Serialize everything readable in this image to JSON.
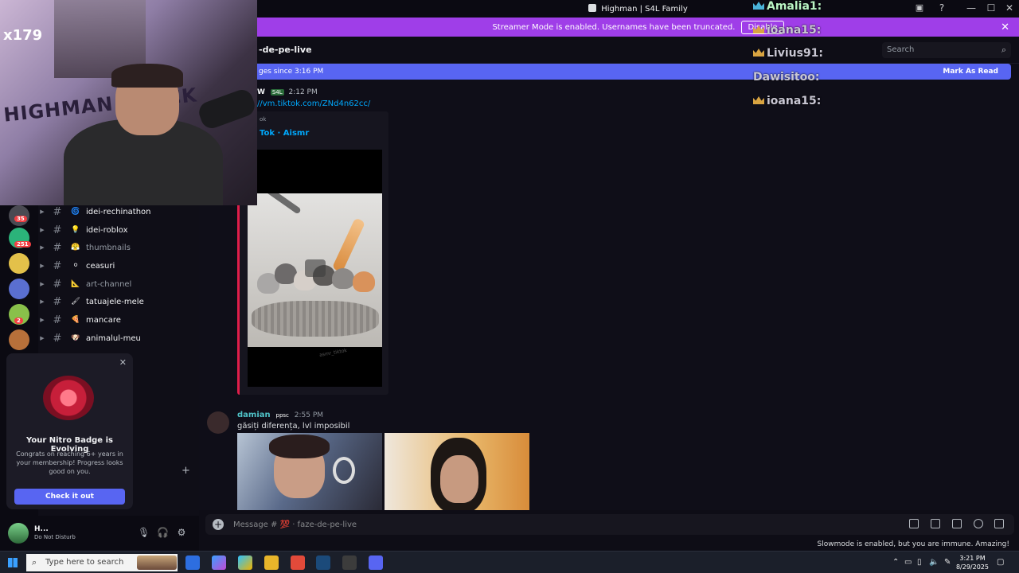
{
  "window": {
    "title": "Highman | S4L Family",
    "minimize": "—",
    "maximize": "☐",
    "close": "✕"
  },
  "banner": {
    "text": "Streamer Mode is enabled. Usernames have been truncated.",
    "disable_label": "Disable",
    "close": "✕"
  },
  "header": {
    "channel_name": "-de-pe-live",
    "search_placeholder": "Search"
  },
  "new_messages": {
    "text": "ges since 3:16 PM",
    "mark_read": "Mark As Read"
  },
  "messages": [
    {
      "author": "W",
      "tag": "S4L",
      "time": "2:12 PM",
      "link": "//vm.tiktok.com/ZNd4n62cc/",
      "embed": {
        "provider": "ok",
        "title": "Tok · Aismr",
        "watermark": "asmr_tiktok"
      }
    },
    {
      "author": "damian",
      "tag": "ppsc",
      "time": "2:55 PM",
      "text": "găsiți diferența, lvl imposibil"
    }
  ],
  "composer": {
    "placeholder": "Message # 💯 · faze-de-pe-live"
  },
  "slowmode": "Slowmode is enabled, but you are immune. Amazing!",
  "channels": [
    {
      "emoji": "🌀",
      "name": "idei-rechinathon",
      "muted": false
    },
    {
      "emoji": "💡",
      "name": "idei-roblox",
      "muted": false
    },
    {
      "emoji": "😤",
      "name": "thumbnails",
      "muted": true
    },
    {
      "emoji": "⚪",
      "name": "ceasuri",
      "muted": false
    },
    {
      "emoji": "📐",
      "name": "art-channel",
      "muted": true
    },
    {
      "emoji": "🖌",
      "name": "tatuajele-mele",
      "muted": false
    },
    {
      "emoji": "🍕",
      "name": "mancare",
      "muted": false
    },
    {
      "emoji": "🐶",
      "name": "animalul-meu",
      "muted": false
    }
  ],
  "server_badges": [
    "35",
    "251",
    "2"
  ],
  "nitro": {
    "heading": "Your Nitro Badge is Evolving",
    "body": "Congrats on reaching 6+ years in your membership! Progress looks good on you.",
    "cta": "Check it out",
    "close": "✕"
  },
  "user": {
    "name": "H...",
    "status": "Do Not Disturb"
  },
  "stream_overlay": {
    "webcam_text": "x179",
    "kick_text": "HIGHMAN X KICK",
    "chat": [
      "Amalia1:",
      "ioana15:",
      "Livius91:",
      "Dawisitoo:",
      "ioana15:"
    ]
  },
  "taskbar": {
    "search_placeholder": "Type here to search",
    "time": "3:21 PM",
    "date": "8/29/2025"
  },
  "colors": {
    "banner": "#9f3ee8",
    "blurple": "#5865f2",
    "embed_border": "#e01e4a",
    "link": "#00a8fc"
  }
}
